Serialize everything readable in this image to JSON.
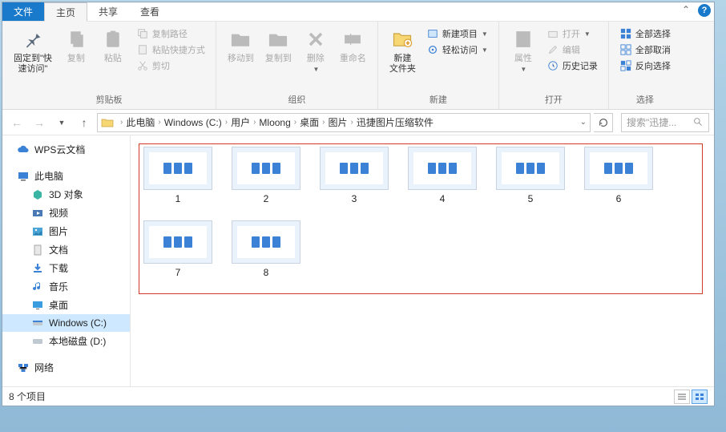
{
  "tabs": {
    "file": "文件",
    "home": "主页",
    "share": "共享",
    "view": "查看"
  },
  "ribbon": {
    "pin": "固定到\"快\n速访问\"",
    "copy": "复制",
    "paste": "粘贴",
    "copypath": "复制路径",
    "pasteshortcut": "粘贴快捷方式",
    "cut": "剪切",
    "group_clipboard": "剪贴板",
    "moveto": "移动到",
    "copyto": "复制到",
    "delete": "删除",
    "rename": "重命名",
    "group_organize": "组织",
    "newfolder": "新建\n文件夹",
    "newitem": "新建项目",
    "easyaccess": "轻松访问",
    "group_new": "新建",
    "properties": "属性",
    "open": "打开",
    "edit": "编辑",
    "history": "历史记录",
    "group_open": "打开",
    "selectall": "全部选择",
    "selectnone": "全部取消",
    "invert": "反向选择",
    "group_select": "选择"
  },
  "breadcrumbs": [
    "此电脑",
    "Windows (C:)",
    "用户",
    "Mloong",
    "桌面",
    "图片",
    "迅捷图片压缩软件"
  ],
  "search_placeholder": "搜索\"迅捷...",
  "sidebar": {
    "wps": "WPS云文档",
    "thispc": "此电脑",
    "objects3d": "3D 对象",
    "videos": "视频",
    "pictures": "图片",
    "documents": "文档",
    "downloads": "下载",
    "music": "音乐",
    "desktop": "桌面",
    "drivec": "Windows (C:)",
    "drived": "本地磁盘 (D:)",
    "network": "网络"
  },
  "items": [
    "1",
    "2",
    "3",
    "4",
    "5",
    "6",
    "7",
    "8"
  ],
  "status_text": "8 个项目"
}
